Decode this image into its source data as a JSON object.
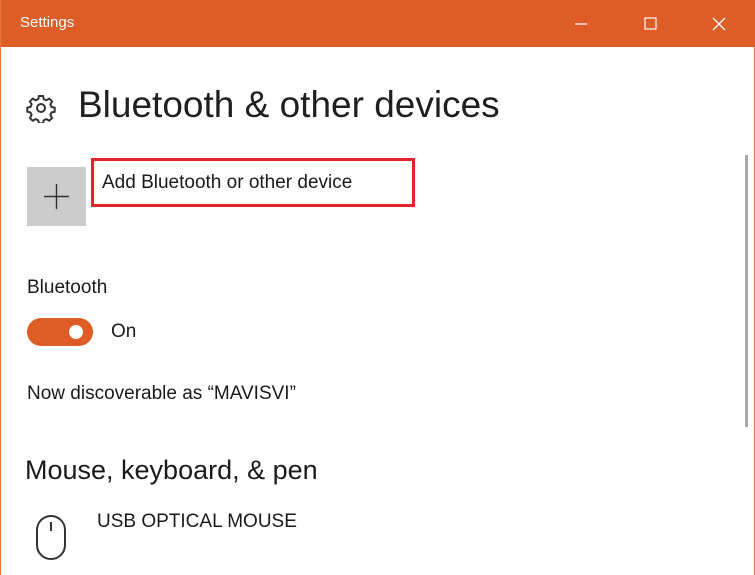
{
  "window": {
    "title": "Settings",
    "accent_color": "#de5c26",
    "controls": [
      "minimize-icon",
      "maximize-icon",
      "close-icon"
    ]
  },
  "page": {
    "title": "Bluetooth & other devices",
    "title_icon": "gear-icon"
  },
  "add_device": {
    "icon": "plus-icon",
    "label": "Add Bluetooth or other device",
    "highlight_color": "#e3232c"
  },
  "bluetooth": {
    "label": "Bluetooth",
    "toggle_state": "On",
    "discoverable_text": "Now discoverable as “MAVISVI”"
  },
  "section": {
    "heading": "Mouse, keyboard, & pen",
    "devices": [
      {
        "icon": "mouse-icon",
        "name": "USB OPTICAL MOUSE"
      }
    ]
  }
}
